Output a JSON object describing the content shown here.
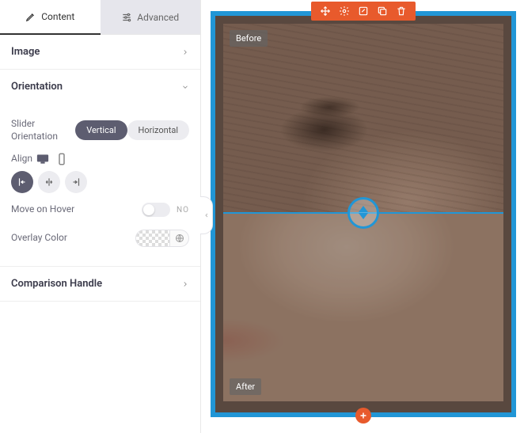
{
  "tabs": {
    "content": "Content",
    "advanced": "Advanced"
  },
  "sections": {
    "image": "Image",
    "orientation": "Orientation",
    "comparison_handle": "Comparison Handle"
  },
  "orientation": {
    "slider_label": "Slider Orientation",
    "vertical": "Vertical",
    "horizontal": "Horizontal",
    "align_label": "Align",
    "hover_label": "Move on Hover",
    "hover_value": "NO",
    "overlay_label": "Overlay Color"
  },
  "preview": {
    "before_label": "Before",
    "after_label": "After"
  }
}
